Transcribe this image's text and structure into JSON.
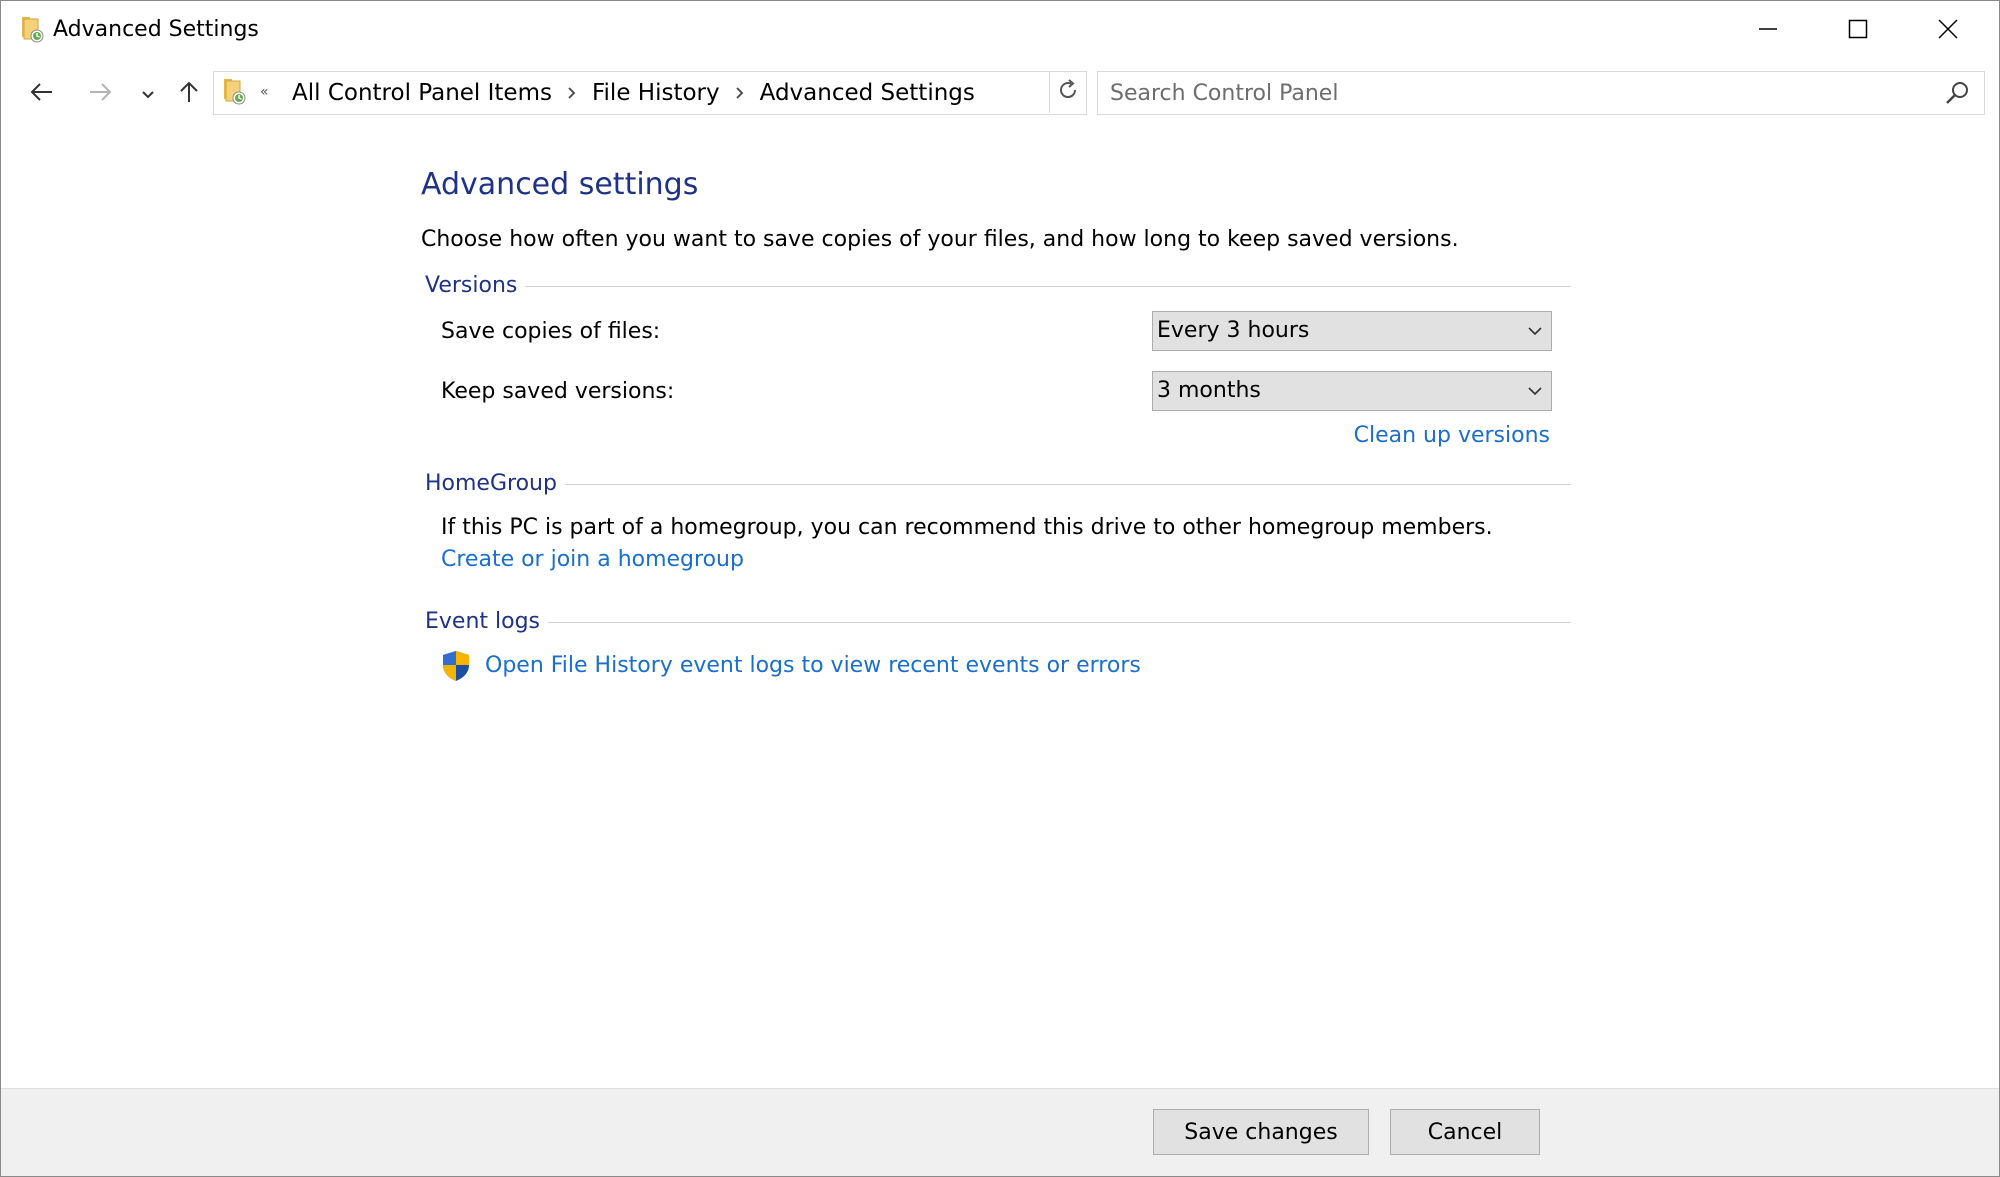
{
  "window": {
    "title": "Advanced Settings",
    "icons": {
      "app": "file-history-folder-icon",
      "minimize": "minimize-icon",
      "maximize": "maximize-icon",
      "close": "close-icon"
    }
  },
  "nav": {
    "icons": {
      "back": "back-arrow-icon",
      "forward": "forward-arrow-icon",
      "recent": "chevron-down-icon",
      "up": "up-arrow-icon"
    }
  },
  "address": {
    "overflow": "«",
    "breadcrumbs": [
      {
        "label": "All Control Panel Items"
      },
      {
        "label": "File History"
      },
      {
        "label": "Advanced Settings"
      }
    ]
  },
  "search": {
    "placeholder": "Search Control Panel",
    "value": ""
  },
  "page": {
    "title": "Advanced settings",
    "description": "Choose how often you want to save copies of your files, and how long to keep saved versions."
  },
  "versions": {
    "group_label": "Versions",
    "save_copies_label": "Save copies of files:",
    "save_copies_value": "Every 3 hours",
    "keep_versions_label": "Keep saved versions:",
    "keep_versions_value": "3 months",
    "cleanup_link": "Clean up versions"
  },
  "homegroup": {
    "group_label": "HomeGroup",
    "text": "If this PC is part of a homegroup, you can recommend this drive to other homegroup members.",
    "link": "Create or join a homegroup"
  },
  "eventlogs": {
    "group_label": "Event logs",
    "link": "Open File History event logs to view recent events or errors",
    "icon": "uac-shield-icon"
  },
  "footer": {
    "save_label": "Save changes",
    "cancel_label": "Cancel"
  },
  "colors": {
    "heading": "#1e3287",
    "link": "#1a6fcc",
    "footer_bg": "#f0f0f0",
    "button_bg": "#e1e1e1"
  }
}
